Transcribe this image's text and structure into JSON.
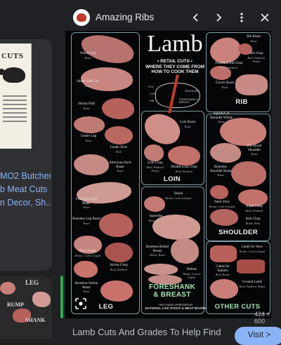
{
  "left_card": {
    "poster_title": "CUTS",
    "lines": [
      "MO2 Butcher",
      "b Meat Cuts",
      "n Decor, Sh..."
    ]
  },
  "left_thumb": {
    "labels": [
      "LEG",
      "RUMP",
      "SHANK"
    ]
  },
  "header": {
    "site_name": "Amazing Ribs"
  },
  "main_image": {
    "title": "Lamb",
    "subtitle": [
      "• RETAIL CUTS •",
      "WHERE THEY COME FROM",
      "HOW TO COOK THEM"
    ],
    "diagram_labels": [
      "LEG",
      "LOIN",
      "RIB",
      "SHOULDER",
      "FORESHANK & BREAST"
    ],
    "sections": {
      "leg": "LEG",
      "loin": "LOIN",
      "rib": "RIB",
      "shoulder": "SHOULDER",
      "foreshank": [
        "FORESHANK",
        "& BREAST"
      ],
      "other": "OTHER CUTS"
    },
    "cuts": {
      "whole_leg": {
        "name": "Whole Leg",
        "method": "Roast"
      },
      "shank_leg": {
        "name": "Shank Half Leg",
        "method": "Roast"
      },
      "sirloin_half": {
        "name": "Sirloin Half",
        "method": "Roast"
      },
      "center_leg": {
        "name": "Center Leg",
        "method": "Roast"
      },
      "center_slice": {
        "name": "Center Slice",
        "method": "Broil"
      },
      "american_leg": {
        "name": "American-Style Roast",
        "method": "Roast"
      },
      "frenched_leg": {
        "name": "Frenched Style Roast",
        "method": "Roast"
      },
      "boneless_leg": {
        "name": "Boneless Leg Roast",
        "method": "Roast"
      },
      "boneless_leg_tied": {
        "name": "Boneless Leg",
        "method": "Roast"
      },
      "hind_shank": {
        "name": "Hind Shank",
        "method": "Braise, Cook in Liquid"
      },
      "sirloin_chop": {
        "name": "Sirloin Chop",
        "method": "Broil, Panbroil"
      },
      "boneless_sirloin": {
        "name": "Boneless Sirloin Roast",
        "method": "Roast"
      },
      "loin_roast": {
        "name": "Loin Roast",
        "method": "Roast"
      },
      "loin_chop": {
        "name": "Loin Chop",
        "method": "Broil, Panbroil, Panfry"
      },
      "double_loin": {
        "name": "Double Loin Chop",
        "method": "Broil, Panbroil"
      },
      "rib_roast": {
        "name": "Rib Roast",
        "method": "Roast"
      },
      "rib_chop": {
        "name": "Rib Chop",
        "method": "Broil, Panbroil, Panfry"
      },
      "frenched_rib": {
        "name": "Frenched Rib Chop",
        "method": "Broil, Panbroil"
      },
      "crown_roast": {
        "name": "Crown Roast",
        "method": "Roast"
      },
      "square_cut": {
        "name": "Square-Cut Shoulder Whole",
        "method": "Roast"
      },
      "pre_sliced": {
        "name": "Pre-Sliced Shoulder",
        "method": "Roast"
      },
      "boneless_shoulder": {
        "name": "Boneless Shoulder Roast",
        "method": "Roast"
      },
      "neck_slice": {
        "name": "Neck Slice",
        "method": "Braise, Cook in Liquid"
      },
      "blade_chop": {
        "name": "Blade Chop",
        "method": "Broil, Panbroil"
      },
      "arm_chop": {
        "name": "Arm Chop",
        "method": "Braise, Broil"
      },
      "shank": {
        "name": "Shank",
        "method": "Braise, Cook in Liquid"
      },
      "spareribs": {
        "name": "Spareribs",
        "method": "Braise, Roast"
      },
      "boneless_rolled": {
        "name": "Boneless Rolled Breast",
        "method": "Braise, Roast"
      },
      "riblets": {
        "name": "Riblets",
        "method": "Braise, Cook in Liquid"
      },
      "stew": {
        "name": "Lamb for Stew",
        "method": "Braise, Cook in Liquid"
      },
      "cubes": {
        "name": "Cubes for Kabobs",
        "method": "Broil, Braise"
      },
      "ground": {
        "name": "Ground Lamb",
        "method": "Broil, Panbroil, Panfry"
      }
    },
    "footnote": [
      "THIS CHART APPROVED BY",
      "NATIONAL LIVE STOCK & MEAT BOARD"
    ],
    "dimensions": "424 × 600"
  },
  "bottom": {
    "title": "Lamb Cuts And Grades To Help Find",
    "visit_label": "Visit >"
  },
  "icons": [
    "site-logo",
    "chevron-left-icon",
    "chevron-right-icon",
    "more-vert-icon",
    "close-icon",
    "lens-icon"
  ],
  "colors": {
    "link": "#8ab4f8",
    "background": "#202124",
    "accent": "#34a853"
  }
}
